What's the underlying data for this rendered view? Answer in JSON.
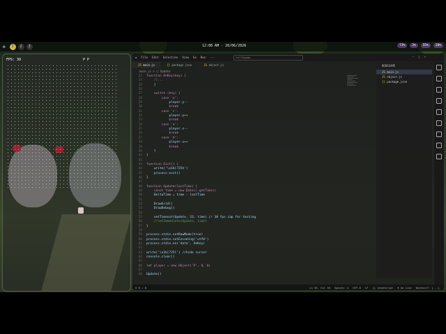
{
  "topbar": {
    "workspaces": [
      "1",
      "2",
      "3"
    ],
    "active_workspace": "1",
    "clock": "12:08 AM - 20/06/2026",
    "tray": [
      "73%",
      "3%",
      "55%",
      "28%"
    ]
  },
  "terminal": {
    "fps": "FPS: 30",
    "players": "P P"
  },
  "editor": {
    "menu": [
      "File",
      "Edit",
      "Selection",
      "View",
      "Go",
      "Run",
      "···"
    ],
    "search_placeholder": "hillOgame",
    "tabs": [
      {
        "label": "main.js"
      },
      {
        "label": "package.json"
      },
      {
        "label": "object.js"
      }
    ],
    "breadcrumb": "main.js > ⬡ Update",
    "explorer_title": "NODEGAME",
    "explorer_files": [
      "main.js",
      "object.js",
      "package.json"
    ],
    "status_left": [
      "⊗ 0 ⚠ 0"
    ],
    "status_right": [
      "Ln 55, Col 38",
      "Spaces: 4",
      "UTF-8",
      "LF",
      "{} JavaScript",
      "⊕ Go Live",
      "Windsurf: {...}"
    ],
    "code": [
      {
        "n": "23",
        "t": "function OnKey(key) {"
      },
      {
        "n": "24",
        "t": "    //..."
      },
      {
        "n": "25",
        "t": "    }"
      },
      {
        "n": "26",
        "t": ""
      },
      {
        "n": "27",
        "t": "    switch (key) {"
      },
      {
        "n": "28",
        "t": "        case 'w':"
      },
      {
        "n": "29",
        "t": "            player.y--"
      },
      {
        "n": "30",
        "t": "            break"
      },
      {
        "n": "31",
        "t": "        case 's':"
      },
      {
        "n": "32",
        "t": "            player.y++"
      },
      {
        "n": "33",
        "t": "            break"
      },
      {
        "n": "34",
        "t": "        case 'a':"
      },
      {
        "n": "35",
        "t": "            player.x--"
      },
      {
        "n": "36",
        "t": "            break"
      },
      {
        "n": "37",
        "t": "        case 'd':"
      },
      {
        "n": "38",
        "t": "            player.x++"
      },
      {
        "n": "39",
        "t": "            break"
      },
      {
        "n": "40",
        "t": "    }"
      },
      {
        "n": "41",
        "t": "}"
      },
      {
        "n": "42",
        "t": ""
      },
      {
        "n": "43",
        "t": "function Exit() {"
      },
      {
        "n": "44",
        "t": "    write('\\x1b[?25h')"
      },
      {
        "n": "45",
        "t": "    process.exit()"
      },
      {
        "n": "46",
        "t": "}"
      },
      {
        "n": "47",
        "t": ""
      },
      {
        "n": "48",
        "t": "function Update(lastTime) {"
      },
      {
        "n": "49",
        "t": "    const time = new Date().getTime()"
      },
      {
        "n": "50",
        "t": "    DeltaTime = time - lastTime"
      },
      {
        "n": "51",
        "t": ""
      },
      {
        "n": "52",
        "t": "    DrawGrid()"
      },
      {
        "n": "53",
        "t": "    DrawDebug()"
      },
      {
        "n": "54",
        "t": ""
      },
      {
        "n": "55",
        "t": "    setTimeout(Update, 33, time) // 30 fps cap for testing"
      },
      {
        "n": "56",
        "t": "    //setImmediate(Update, time)"
      },
      {
        "n": "57",
        "t": "}"
      },
      {
        "n": "58",
        "t": ""
      },
      {
        "n": "59",
        "t": "process.stdin.setRawMode(true)"
      },
      {
        "n": "60",
        "t": "process.stdin.setEncoding('utf8')"
      },
      {
        "n": "61",
        "t": "process.stdin.on('data', OnKey)"
      },
      {
        "n": "62",
        "t": ""
      },
      {
        "n": "63",
        "t": "write('\\x1b[?25l') //hide cursor"
      },
      {
        "n": "64",
        "t": "console.clear()"
      },
      {
        "n": "65",
        "t": ""
      },
      {
        "n": "66",
        "t": "let player = new Object('P', 0, 0)"
      },
      {
        "n": "67",
        "t": ""
      },
      {
        "n": "68",
        "t": "Update()"
      }
    ]
  },
  "colors": {
    "accent": "#d6b84a",
    "keyword": "#569cd6",
    "function": "#dcdcaa",
    "string": "#ce9178",
    "comment": "#6a9955"
  }
}
